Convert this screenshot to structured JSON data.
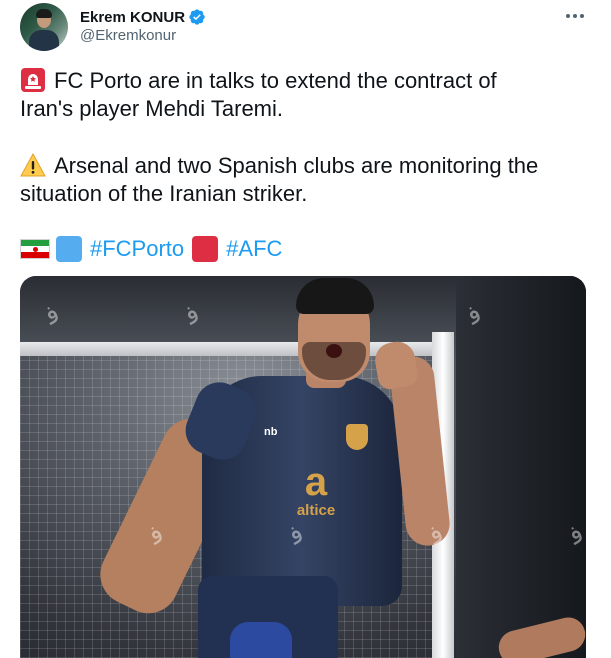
{
  "author": {
    "display_name": "Ekrem KONUR",
    "handle": "@Ekremkonur",
    "verified_color": "#1d9bf0"
  },
  "tweet": {
    "para1_line1": "FC Porto are in talks to extend the contract of",
    "para1_line2": "Iran's player Mehdi Taremi.",
    "para2_line1": "Arsenal and two Spanish clubs are monitoring the",
    "para2_line2": "situation of the Iranian striker.",
    "hashtags": [
      "#FCPorto",
      "#AFC"
    ],
    "emoji_icons": [
      "siren-icon",
      "warning-icon",
      "iran-flag-icon",
      "blue-square-icon",
      "red-square-icon"
    ]
  },
  "media": {
    "sponsor_mark": "a",
    "sponsor_text": "altice",
    "kit_brand": "nb"
  },
  "colors": {
    "link": "#1d9bf0",
    "text": "#0f1419",
    "secondary": "#536471"
  }
}
